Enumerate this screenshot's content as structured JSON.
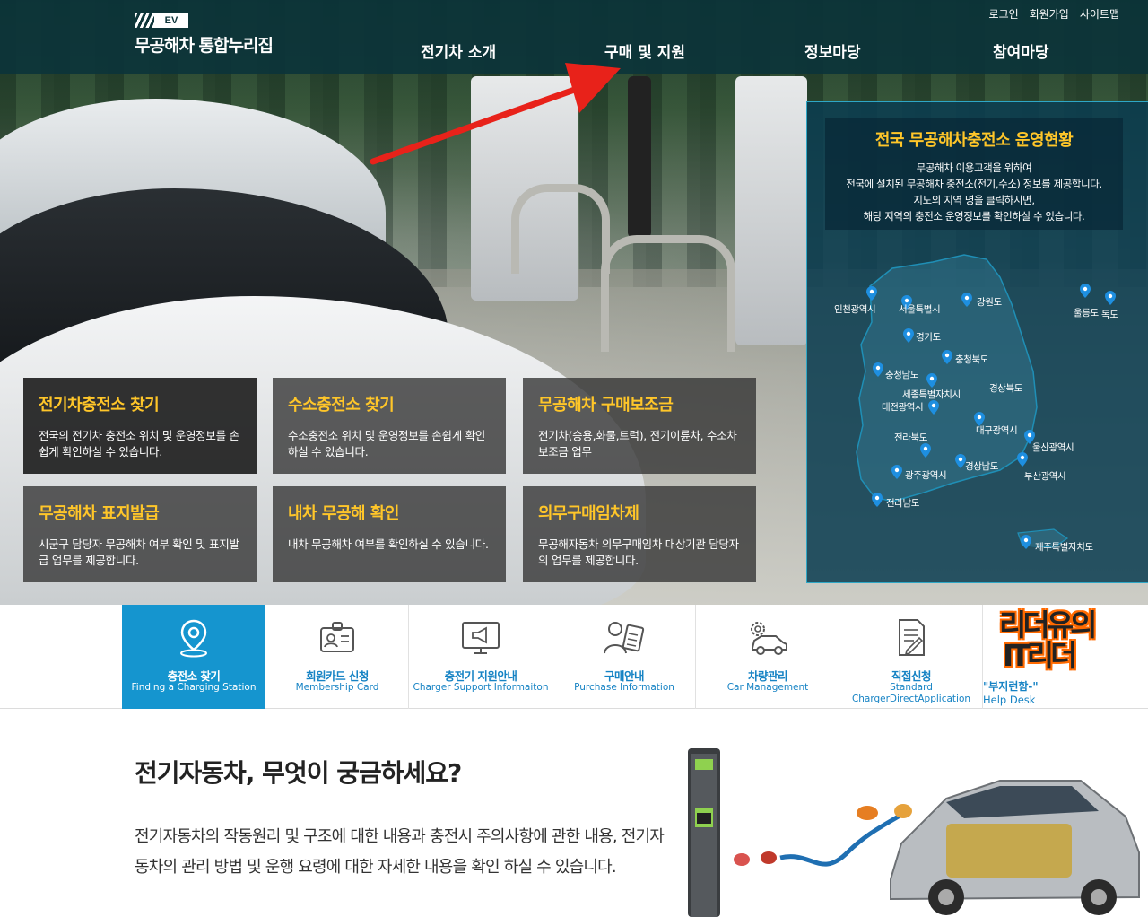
{
  "header": {
    "logo_tag": "EV",
    "logo_text": "무공해차 통합누리집",
    "util_links": [
      "로그인",
      "회원가입",
      "사이트맵"
    ],
    "nav": [
      "전기차 소개",
      "구매 및 지원",
      "정보마당",
      "참여마당"
    ]
  },
  "info_boxes": [
    {
      "title": "전기차충전소 찾기",
      "desc": "전국의 전기차 충전소 위치 및 운영정보를 손쉽게 확인하실 수 있습니다."
    },
    {
      "title": "수소충전소 찾기",
      "desc": "수소충전소 위치 및 운영정보를 손쉽게 확인하실 수 있습니다."
    },
    {
      "title": "무공해차 구매보조금",
      "desc": "전기차(승용,화물,트럭), 전기이륜차, 수소차 보조금 업무"
    },
    {
      "title": "무공해차 표지발급",
      "desc": "시군구 담당자 무공해차 여부 확인 및 표지발급 업무를 제공합니다."
    },
    {
      "title": "내차 무공해 확인",
      "desc": "내차 무공해차 여부를 확인하실 수 있습니다."
    },
    {
      "title": "의무구매임차제",
      "desc": "무공해자동차 의무구매임차 대상기관 담당자의 업무를 제공합니다."
    }
  ],
  "map": {
    "title": "전국 무공해차충전소 운영현황",
    "desc": [
      "무공해차 이용고객을 위하여",
      "전국에 설치된 무공해차 충전소(전기,수소) 정보를 제공합니다.",
      "지도의 지역 명을 클릭하시면,",
      "해당 지역의 충전소 운영정보를 확인하실 수 있습니다."
    ],
    "regions": [
      "인천광역시",
      "서울특별시",
      "강원도",
      "울릉도",
      "독도",
      "경기도",
      "충청북도",
      "충청남도",
      "세종특별자치시",
      "대전광역시",
      "경상북도",
      "대구광역시",
      "전라북도",
      "울산광역시",
      "경상남도",
      "광주광역시",
      "부산광역시",
      "전라남도",
      "제주특별자치도"
    ]
  },
  "quick_menu": [
    {
      "ko": "충전소 찾기",
      "en": "Finding a Charging Station",
      "icon": "location-pin-icon"
    },
    {
      "ko": "회원카드 신청",
      "en": "Membership Card",
      "icon": "id-card-icon"
    },
    {
      "ko": "충전기 지원안내",
      "en": "Charger Support Informaiton",
      "icon": "monitor-megaphone-icon"
    },
    {
      "ko": "구매안내",
      "en": "Purchase Information",
      "icon": "person-document-icon"
    },
    {
      "ko": "차량관리",
      "en": "Car Management",
      "icon": "car-gear-icon"
    },
    {
      "ko": "직접신청",
      "en": "Standard ChargerDirectApplication",
      "icon": "document-pen-icon"
    }
  ],
  "promo": {
    "line1": "리더유의",
    "line2": "IT리더",
    "small": "\"부지런함-\"",
    "help": "Help Desk"
  },
  "content": {
    "title": "전기자동차, 무엇이 궁금하세요?",
    "desc": "전기자동차의 작동원리 및 구조에 대한 내용과 충전시 주의사항에 관한 내용, 전기자동차의 관리 방법 및 운행 요령에 대한 자세한 내용을 확인 하실 수 있습니다."
  },
  "colors": {
    "header_bg": "#0c343a",
    "accent_yellow": "#ffc629",
    "quick_active": "#1595cf",
    "quick_text": "#1683c4",
    "arrow_red": "#e8221a"
  }
}
